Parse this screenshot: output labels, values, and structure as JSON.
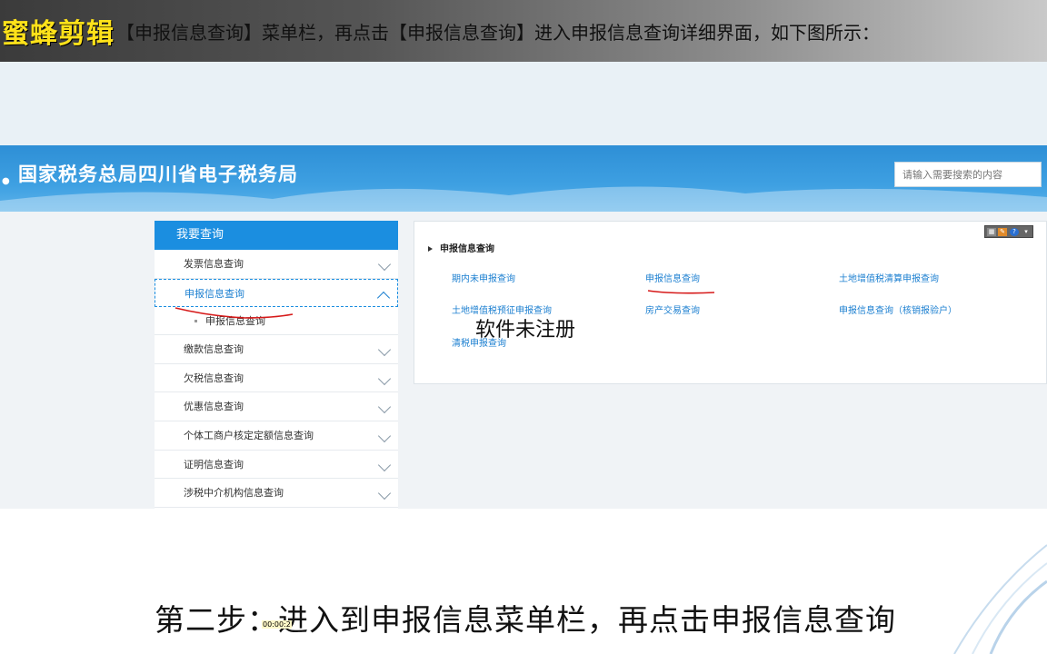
{
  "banner": {
    "brand": "蜜蜂剪辑",
    "text": "【申报信息查询】菜单栏，再点击【申报信息查询】进入申报信息查询详细界面，如下图所示："
  },
  "site": {
    "title": "国家税务总局四川省电子税务局",
    "search_placeholder": "请输入需要搜索的内容"
  },
  "menu": {
    "header": "我要查询",
    "items": [
      {
        "label": "发票信息查询"
      },
      {
        "label": "申报信息查询",
        "active": true
      },
      {
        "label": "缴款信息查询"
      },
      {
        "label": "欠税信息查询"
      },
      {
        "label": "优惠信息查询"
      },
      {
        "label": "个体工商户核定定额信息查询"
      },
      {
        "label": "证明信息查询"
      },
      {
        "label": "涉税中介机构信息查询"
      }
    ],
    "sub_item": "申报信息查询"
  },
  "panel": {
    "title": "申报信息查询",
    "links": [
      "期内未申报查询",
      "申报信息查询",
      "土地增值税清算申报查询",
      "土地增值税预征申报查询",
      "房产交易查询",
      "申报信息查询（核销报验户）",
      "清税申报查询"
    ],
    "toolbar": [
      "?"
    ]
  },
  "watermark": "软件未注册",
  "caption": "第二步：进入到申报信息菜单栏，再点击申报信息查询",
  "timestamp": "00:00:2",
  "colors": {
    "accent": "#1b8ee0",
    "header": "#3ea0e2",
    "annotation": "#d61a1a",
    "brand": "#ffe21a"
  }
}
